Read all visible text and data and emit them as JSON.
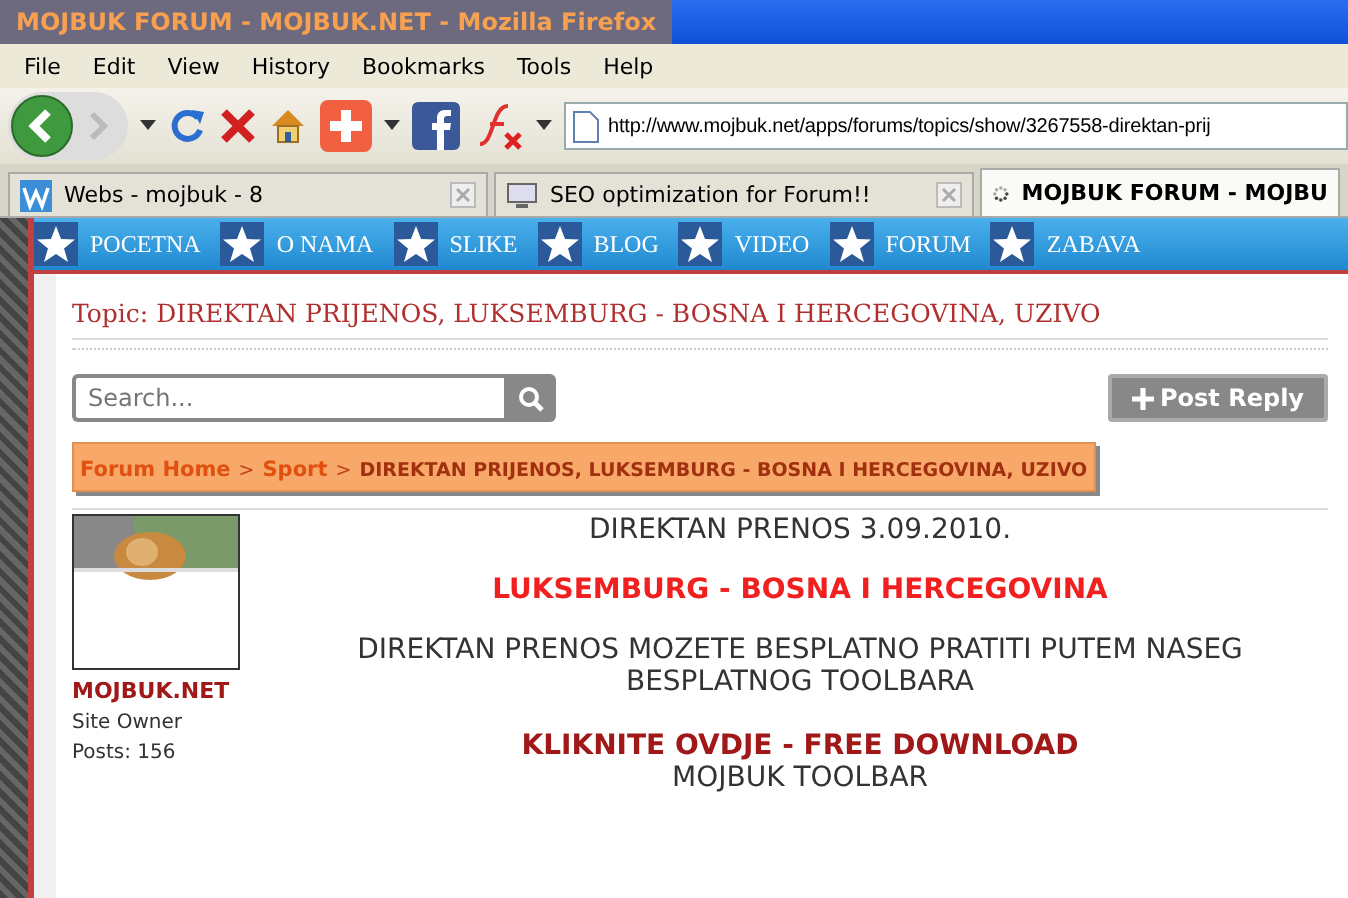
{
  "window": {
    "title": "MOJBUK FORUM - MOJBUK.NET - Mozilla Firefox"
  },
  "menu": [
    "File",
    "Edit",
    "View",
    "History",
    "Bookmarks",
    "Tools",
    "Help"
  ],
  "toolbar": {
    "url": "http://www.mojbuk.net/apps/forums/topics/show/3267558-direktan-prij"
  },
  "tabs": [
    {
      "label": "Webs - mojbuk - 8",
      "selected": false,
      "kind": "site"
    },
    {
      "label": "SEO optimization for Forum!!",
      "selected": false,
      "kind": "page"
    },
    {
      "label": "MOJBUK FORUM - MOJBU",
      "selected": true,
      "kind": "loading"
    }
  ],
  "nav": [
    "POCETNA",
    "O NAMA",
    "SLIKE",
    "BLOG",
    "VIDEO",
    "FORUM",
    "ZABAVA"
  ],
  "topic": {
    "title": "Topic: DIREKTAN PRIJENOS, LUKSEMBURG - BOSNA I HERCEGOVINA, UZIVO"
  },
  "search": {
    "placeholder": "Search..."
  },
  "post_reply": {
    "label": "Post Reply"
  },
  "breadcrumb": {
    "separator": ">",
    "items": [
      {
        "label": "Forum Home",
        "kind": "link"
      },
      {
        "label": "Sport",
        "kind": "link"
      },
      {
        "label": "DIREKTAN PRIJENOS, LUKSEMBURG - BOSNA I HERCEGOVINA, UZIVO",
        "kind": "current"
      }
    ]
  },
  "post": {
    "author": "MOJBUK.NET",
    "role": "Site Owner",
    "posts": "Posts: 156",
    "body": [
      {
        "text": "DIREKTAN PRENOS 3.09.2010.",
        "kind": "plain"
      },
      {
        "text": "LUKSEMBURG - BOSNA I HERCEGOVINA",
        "kind": "highlight"
      },
      {
        "text": "DIREKTAN PRENOS MOZETE BESPLATNO PRATITI PUTEM NASEG BESPLATNOG TOOLBARA",
        "kind": "plain"
      },
      {
        "text": "KLIKNITE OVDJE - FREE DOWNLOAD",
        "kind": "link"
      },
      {
        "text": "MOJBUK TOOLBAR",
        "kind": "plain"
      }
    ]
  }
}
